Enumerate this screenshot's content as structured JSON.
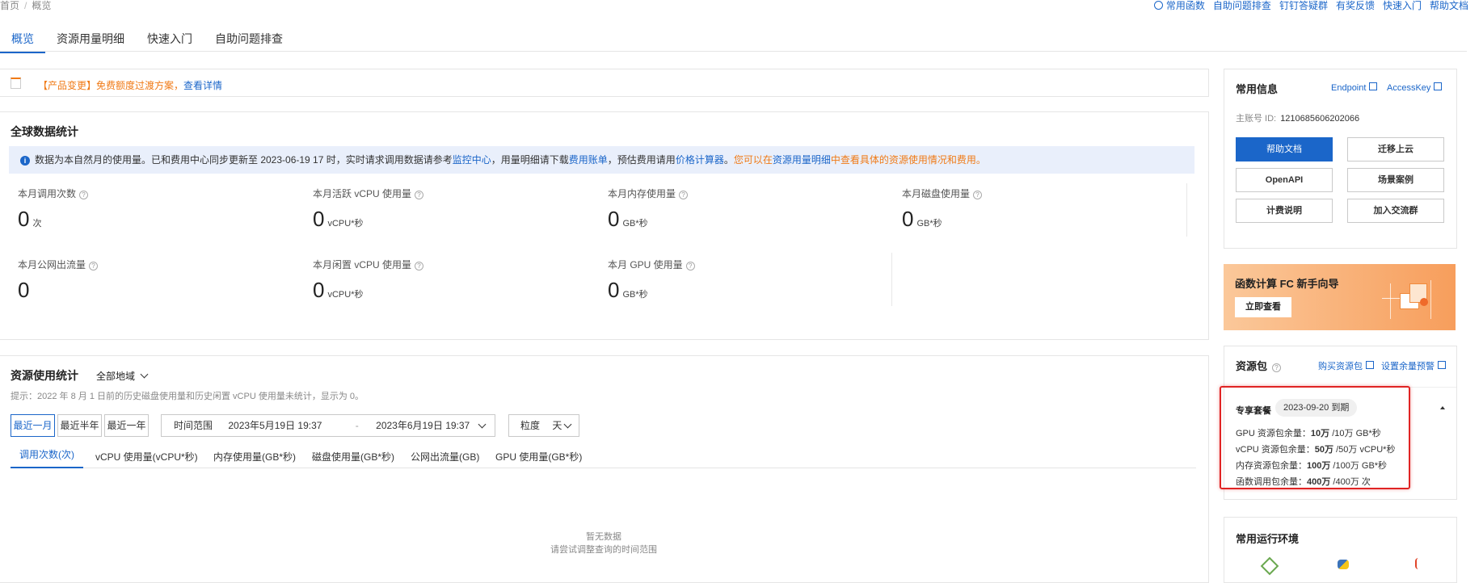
{
  "breadcrumb": {
    "home": "首页",
    "sep": "/",
    "current": "概览"
  },
  "top_links": [
    "常用函数",
    "自助问题排查",
    "钉钉答疑群",
    "有奖反馈",
    "快速入门",
    "帮助文档"
  ],
  "tabs": [
    "概览",
    "资源用量明细",
    "快速入门",
    "自助问题排查"
  ],
  "notice": {
    "prefix": "【产品变更】免费额度过渡方案，",
    "link": "查看详情"
  },
  "global_stats": {
    "title": "全球数据统计",
    "info": {
      "t1": "数据为本自然月的使用量。已和费用中心同步更新至 2023-06-19 17 时，实时请求调用数据请参考",
      "l1": "监控中心",
      "t2": "，用量明细请下载",
      "l2": "费用账单",
      "t3": "，预估费用请用",
      "l3": "价格计算器",
      "t4": "。",
      "o1": "您可以在",
      "l4": "资源用量明细",
      "o2": "中查看具体的资源使用情况和费用。"
    },
    "metrics": [
      {
        "label": "本月调用次数",
        "value": "0",
        "unit": "次"
      },
      {
        "label": "本月活跃 vCPU 使用量",
        "value": "0",
        "unit": "vCPU*秒"
      },
      {
        "label": "本月内存使用量",
        "value": "0",
        "unit": "GB*秒"
      },
      {
        "label": "本月磁盘使用量",
        "value": "0",
        "unit": "GB*秒"
      },
      {
        "label": "本月公网出流量",
        "value": "0",
        "unit": ""
      },
      {
        "label": "本月闲置 vCPU 使用量",
        "value": "0",
        "unit": "vCPU*秒"
      },
      {
        "label": "本月 GPU 使用量",
        "value": "0",
        "unit": "GB*秒"
      }
    ]
  },
  "usage": {
    "title": "资源使用统计",
    "region": "全部地域",
    "hint": "提示：2022 年 8 月 1 日前的历史磁盘使用量和历史闲置 vCPU 使用量未统计，显示为 0。",
    "ranges": [
      "最近一月",
      "最近半年",
      "最近一年"
    ],
    "time_label": "时间范围",
    "start": "2023年5月19日 19:37",
    "dash": "-",
    "end": "2023年6月19日 19:37",
    "granularity_label": "粒度",
    "granularity": "天",
    "subtabs": [
      "调用次数(次)",
      "vCPU 使用量(vCPU*秒)",
      "内存使用量(GB*秒)",
      "磁盘使用量(GB*秒)",
      "公网出流量(GB)",
      "GPU 使用量(GB*秒)"
    ],
    "empty_title": "暂无数据",
    "empty_hint": "请尝试调整查询的时间范围"
  },
  "common_info": {
    "title": "常用信息",
    "endpoint": "Endpoint",
    "accesskey": "AccessKey",
    "account_label": "主账号 ID:",
    "account_id": "1210685606202066",
    "buttons": [
      "帮助文档",
      "迁移上云",
      "OpenAPI",
      "场景案例",
      "计费说明",
      "加入交流群"
    ]
  },
  "banner": {
    "title": "函数计算 FC 新手向导",
    "button": "立即查看"
  },
  "packages": {
    "title": "资源包",
    "buy": "购买资源包",
    "alert": "设置余量预警",
    "plan": "专享套餐",
    "expire": "2023-09-20 到期",
    "rows": [
      {
        "label": "GPU 资源包余量：",
        "remain": "10万",
        "total": "/10万 GB*秒"
      },
      {
        "label": "vCPU 资源包余量：",
        "remain": "50万",
        "total": "/50万 vCPU*秒"
      },
      {
        "label": "内存资源包余量：",
        "remain": "100万",
        "total": "/100万 GB*秒"
      },
      {
        "label": "函数调用包余量：",
        "remain": "400万",
        "total": "/400万 次"
      }
    ]
  },
  "runtime": {
    "title": "常用运行环境"
  }
}
